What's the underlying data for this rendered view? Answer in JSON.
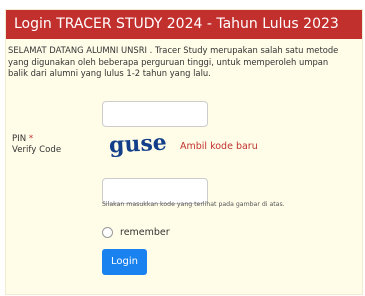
{
  "panel": {
    "title": "Login TRACER STUDY 2024 - Tahun Lulus 2023",
    "intro": "SELAMAT DATANG ALUMNI UNSRI . Tracer Study merupakan salah satu metode yang digunakan oleh beberapa perguruan tinggi, untuk memperoleh umpan balik dari alumni yang lulus 1-2 tahun yang lalu."
  },
  "form": {
    "pin_label": "PIN",
    "required_marker": "*",
    "pin_value": "",
    "verify_label": "Verify Code",
    "captcha_text": "guse",
    "refresh_label": "Ambil kode baru",
    "verify_value": "",
    "help_text": "Silakan masukkan kode yang terlihat pada gambar di atas.",
    "remember_label": "remember",
    "login_label": "Login"
  },
  "colors": {
    "header": "#c2302e",
    "panel_bg": "#fffde8",
    "button": "#1a82ee",
    "captcha": "#123e8a",
    "link": "#c2302e"
  }
}
